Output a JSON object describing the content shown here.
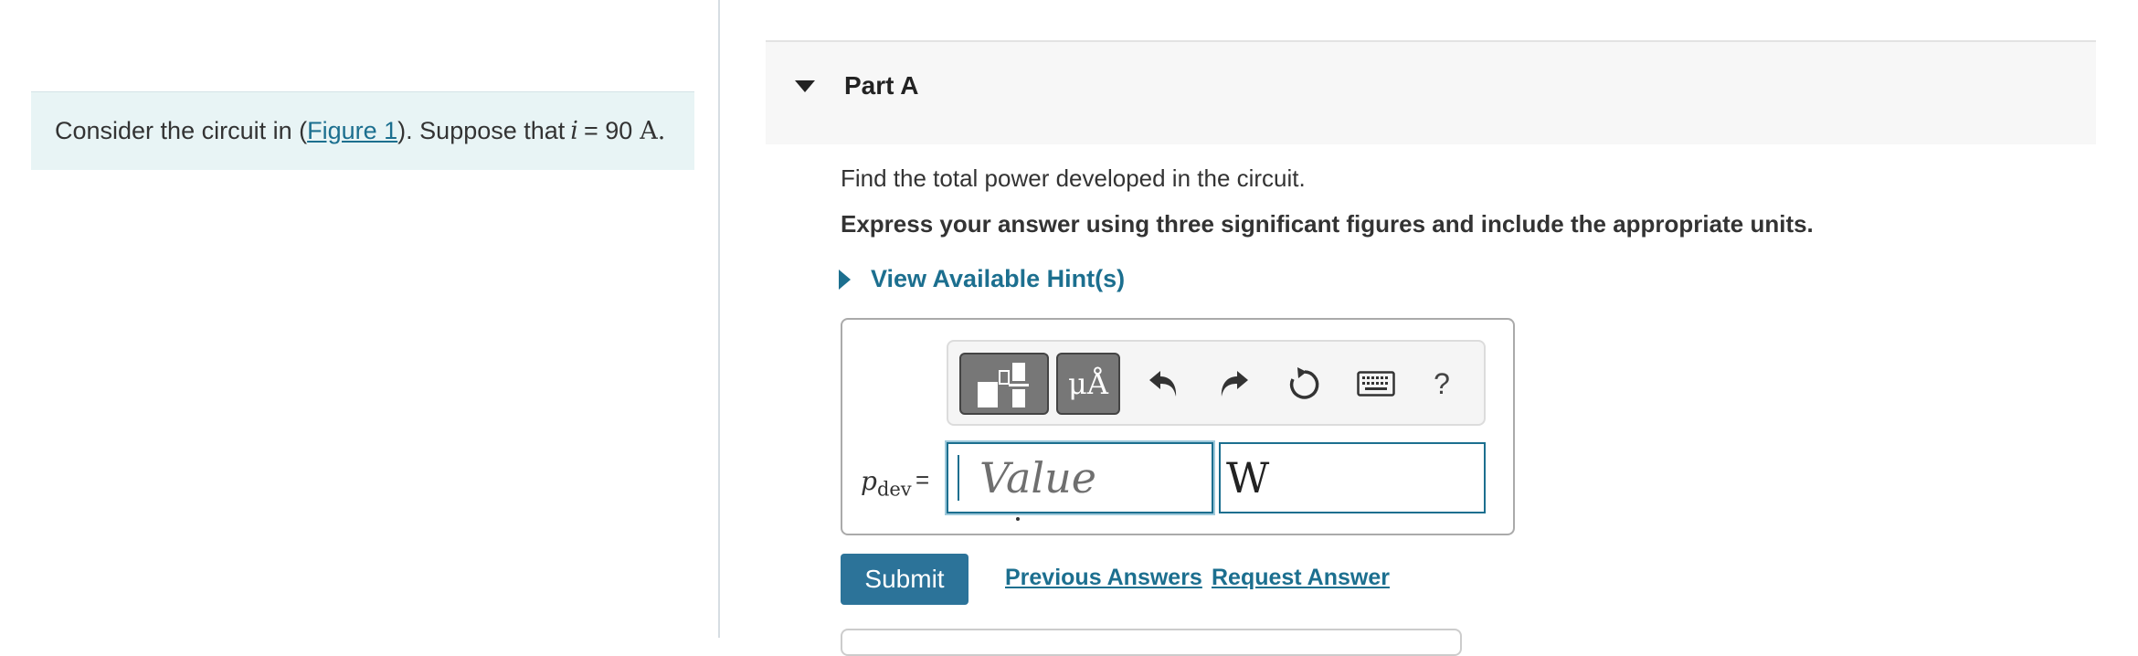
{
  "problem": {
    "prefix": "Consider the circuit in (",
    "figure_link": "Figure 1",
    "suffix": "). Suppose that",
    "variable": "i",
    "equals": "= 90",
    "unit": "A."
  },
  "part": {
    "title": "Part A",
    "question": "Find the total power developed in the circuit.",
    "instruction": "Express your answer using three significant figures and include the appropriate units.",
    "hint_link": "View Available Hint(s)"
  },
  "toolbar": {
    "templates_icon": "templates-icon",
    "units_label": "μÅ",
    "undo_icon": "undo-icon",
    "redo_icon": "redo-icon",
    "reset_icon": "reset-icon",
    "keyboard_icon": "keyboard-icon",
    "help_label": "?"
  },
  "answer": {
    "variable_main": "p",
    "variable_sub": "dev",
    "equals": "=",
    "value_placeholder": "Value",
    "value": "",
    "unit_value": "W"
  },
  "actions": {
    "submit_label": "Submit",
    "previous_answers_label": "Previous Answers",
    "request_answer_label": "Request Answer"
  },
  "colors": {
    "accent": "#1c6f8f",
    "submit_bg": "#2c7399",
    "problem_bg": "#e8f4f5",
    "part_header_bg": "#f7f7f7"
  }
}
